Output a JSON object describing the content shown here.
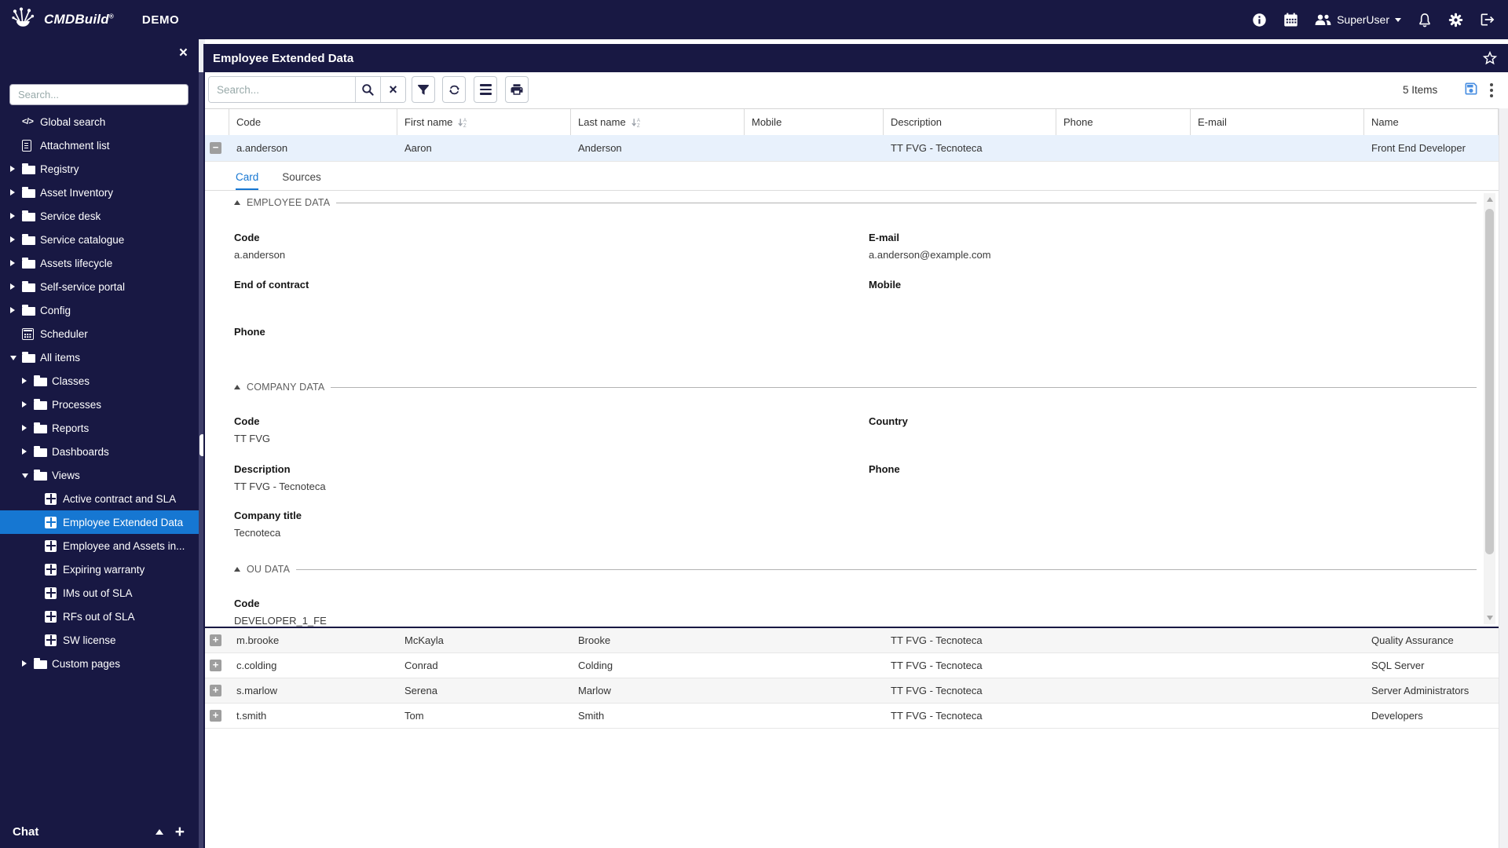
{
  "colors": {
    "navy": "#181843",
    "accent": "#1677d2",
    "selected_row": "#e8f1fc",
    "save_icon": "#4a8fe2"
  },
  "icons": {
    "close": "×",
    "clear": "×",
    "code": "</>",
    "collapse_row": "−",
    "expand_row": "+",
    "chat_add": "+"
  },
  "topbar": {
    "app_name": "CMDBuild",
    "reg_mark": "®",
    "env": "DEMO",
    "user_label": "SuperUser"
  },
  "sidebar": {
    "search_placeholder": "Search...",
    "chat_label": "Chat",
    "items": [
      {
        "label": "Global search"
      },
      {
        "label": "Attachment list"
      },
      {
        "label": "Registry"
      },
      {
        "label": "Asset Inventory"
      },
      {
        "label": "Service desk"
      },
      {
        "label": "Service catalogue"
      },
      {
        "label": "Assets lifecycle"
      },
      {
        "label": "Self-service portal"
      },
      {
        "label": "Config"
      },
      {
        "label": "Scheduler"
      },
      {
        "label": "All items"
      },
      {
        "label": "Classes"
      },
      {
        "label": "Processes"
      },
      {
        "label": "Reports"
      },
      {
        "label": "Dashboards"
      },
      {
        "label": "Views"
      },
      {
        "label": "Active contract and SLA"
      },
      {
        "label": "Employee Extended Data"
      },
      {
        "label": "Employee and Assets in..."
      },
      {
        "label": "Expiring warranty"
      },
      {
        "label": "IMs out of SLA"
      },
      {
        "label": "RFs out of SLA"
      },
      {
        "label": "SW license"
      },
      {
        "label": "Custom pages"
      }
    ]
  },
  "page": {
    "title": "Employee Extended Data"
  },
  "toolbar": {
    "search_placeholder": "Search...",
    "items_count": "5 Items"
  },
  "grid": {
    "columns": [
      "Code",
      "First name",
      "Last name",
      "Mobile",
      "Description",
      "Phone",
      "E-mail",
      "Name"
    ],
    "rows": [
      {
        "code": "a.anderson",
        "first_name": "Aaron",
        "last_name": "Anderson",
        "mobile": "",
        "description": "TT FVG - Tecnoteca",
        "phone": "",
        "email": "",
        "name": "Front End Developer"
      },
      {
        "code": "m.brooke",
        "first_name": "McKayla",
        "last_name": "Brooke",
        "mobile": "",
        "description": "TT FVG - Tecnoteca",
        "phone": "",
        "email": "",
        "name": "Quality Assurance"
      },
      {
        "code": "c.colding",
        "first_name": "Conrad",
        "last_name": "Colding",
        "mobile": "",
        "description": "TT FVG - Tecnoteca",
        "phone": "",
        "email": "",
        "name": "SQL Server"
      },
      {
        "code": "s.marlow",
        "first_name": "Serena",
        "last_name": "Marlow",
        "mobile": "",
        "description": "TT FVG - Tecnoteca",
        "phone": "",
        "email": "",
        "name": "Server Administrators"
      },
      {
        "code": "t.smith",
        "first_name": "Tom",
        "last_name": "Smith",
        "mobile": "",
        "description": "TT FVG - Tecnoteca",
        "phone": "",
        "email": "",
        "name": "Developers"
      }
    ]
  },
  "card": {
    "tabs": {
      "card": "Card",
      "sources": "Sources"
    },
    "employee": {
      "title": "EMPLOYEE DATA",
      "code_label": "Code",
      "code_value": "a.anderson",
      "email_label": "E-mail",
      "email_value": "a.anderson@example.com",
      "end_of_contract_label": "End of contract",
      "mobile_label": "Mobile",
      "phone_label": "Phone"
    },
    "company": {
      "title": "COMPANY DATA",
      "code_label": "Code",
      "code_value": "TT FVG",
      "country_label": "Country",
      "description_label": "Description",
      "description_value": "TT FVG - Tecnoteca",
      "phone_label": "Phone",
      "company_title_label": "Company title",
      "company_title_value": "Tecnoteca"
    },
    "ou": {
      "title": "OU DATA",
      "code_label": "Code",
      "code_value": "DEVELOPER_1_FE"
    }
  }
}
